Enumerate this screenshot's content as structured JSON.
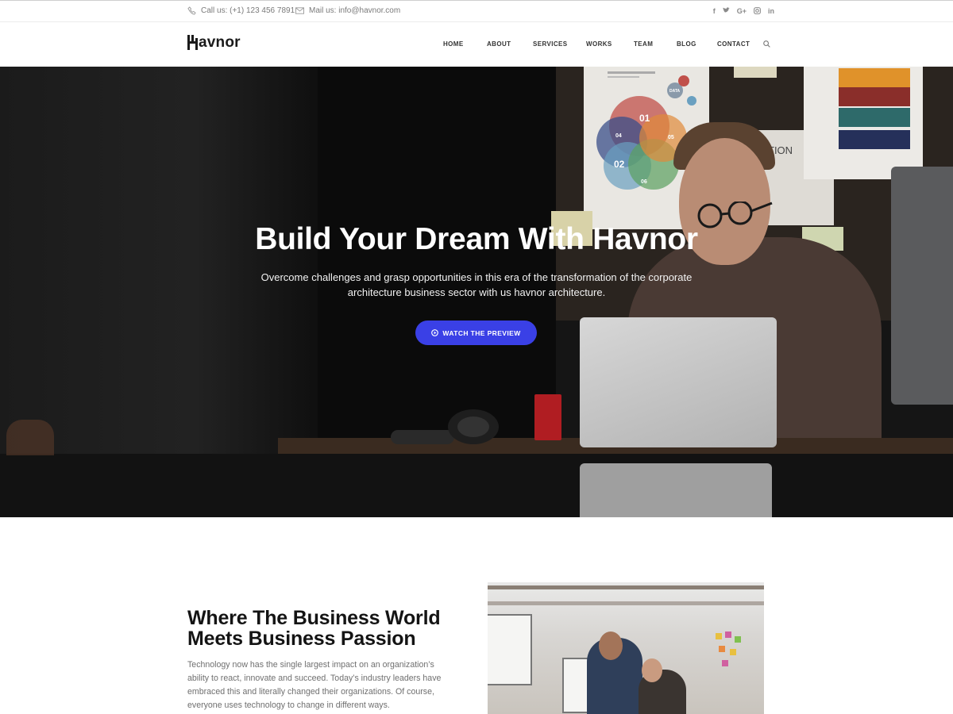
{
  "topbar": {
    "phone_icon": "phone-icon",
    "phone_text": "Call us: (+1) 123 456 7891",
    "mail_icon": "envelope-icon",
    "mail_text": "Mail us: info@havnor.com",
    "socials": [
      {
        "icon": "facebook-icon",
        "glyph": "f"
      },
      {
        "icon": "twitter-icon",
        "glyph": "t"
      },
      {
        "icon": "google-plus-icon",
        "glyph": "G+"
      },
      {
        "icon": "instagram-icon",
        "glyph": "ig"
      },
      {
        "icon": "linkedin-icon",
        "glyph": "in"
      }
    ]
  },
  "nav": {
    "logo_text": "avnor",
    "logo_full": "Havnor",
    "items": [
      "HOME",
      "ABOUT",
      "SERVICES",
      "WORKS",
      "TEAM",
      "BLOG",
      "CONTACT"
    ],
    "search_icon": "search-icon"
  },
  "hero": {
    "title": "Build Your Dream With Havnor",
    "subtitle": "Overcome challenges and grasp opportunities in this era of the transformation of the corporate architecture business sector with us havnor architecture.",
    "cta_label": "WATCH THE PREVIEW",
    "cta_icon": "play-circle-icon",
    "poster_numbers": [
      "01",
      "02",
      "04",
      "05",
      "06"
    ],
    "poster_badge": "DATA",
    "poster_text": "TION"
  },
  "about": {
    "title": "Where The Business World Meets Business Passion",
    "text": "Technology now has the single largest impact on an organization’s ability to react, innovate and succeed. Today’s industry leaders have embraced this and literally changed their organizations. Of course, everyone uses technology to change in different ways."
  },
  "colors": {
    "accent": "#3a40e6",
    "text_dark": "#141414",
    "text_muted": "#6f6f6f"
  }
}
